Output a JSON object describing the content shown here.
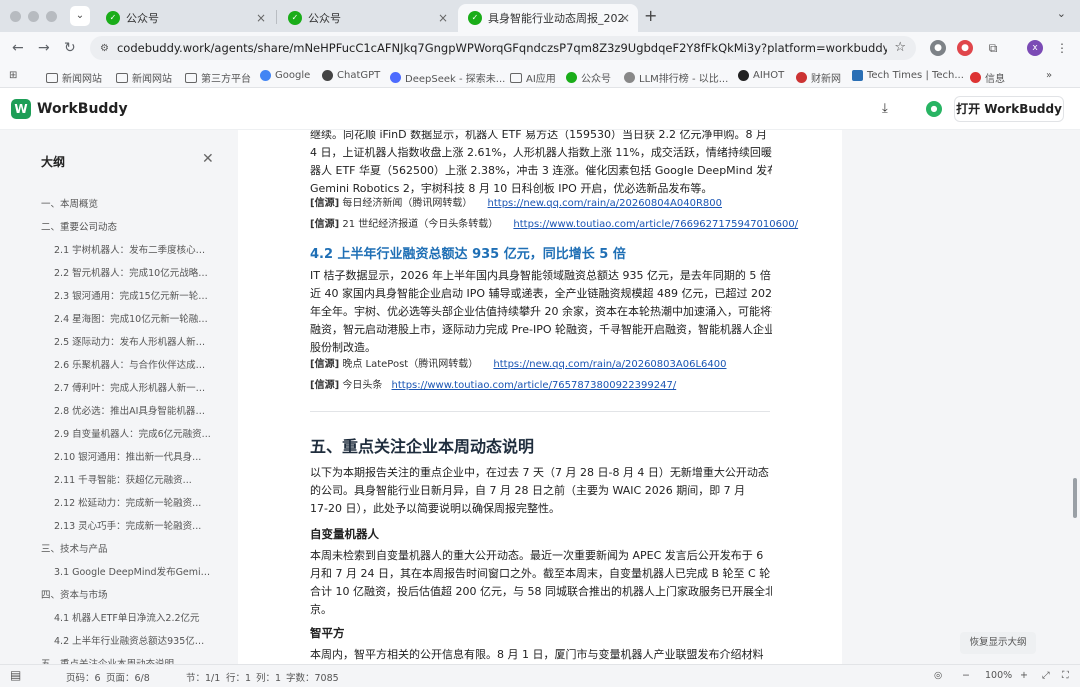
{
  "browser": {
    "tabs": [
      {
        "title": "公众号",
        "active": false
      },
      {
        "title": "公众号",
        "active": false
      },
      {
        "title": "具身智能行业动态周报_20260",
        "active": true
      }
    ],
    "tab_dropdown": "⌄",
    "new_tab": "+",
    "url": "codebuddy.work/agents/share/mNeHPFucC1cAFNJkq7GngpWPWorqGFqndczsP7qm8Z3z9UgbdqeF2Y8fFkQkMi3y?platform=workbuddy&ext2=brow...",
    "bookmarks": [
      "新闻网站",
      "新闻网站",
      "第三方平台",
      "Google",
      "ChatGPT",
      "DeepSeek - 探索未...",
      "AI应用",
      "公众号",
      "LLM排行榜 - 以比...",
      "AIHOT",
      "财新网",
      "Tech Times | Tech...",
      "信息"
    ],
    "ext_profile": "x"
  },
  "app": {
    "title": "WorkBuddy",
    "open_button": "打开 WorkBuddy"
  },
  "outline": {
    "title": "大纲",
    "items": [
      "一、本周概览",
      "二、重要公司动态",
      "2.1 宇树机器人：发布二季度核心进...",
      "2.2 智元机器人：完成10亿元战略投资...",
      "2.3 银河通用：完成15亿元新一轮融资...",
      "2.4 星海图：完成10亿元新一轮融资...",
      "2.5 逐际动力：发布人形机器人新品...",
      "2.6 乐聚机器人：与合作伙伴达成战略...",
      "2.7 傅利叶：完成人形机器人新一轮...",
      "2.8 优必选：推出AI具身智能机器人...",
      "2.9 自变量机器人：完成6亿元融资...",
      "2.10 银河通用：推出新一代具身...",
      "2.11 千寻智能：获超亿元融资...",
      "2.12 松延动力：完成新一轮融资...",
      "2.13 灵心巧手：完成新一轮融资...",
      "三、技术与产品",
      "3.1 Google DeepMind发布Gemini R...",
      "四、资本与市场",
      "4.1 机器人ETF单日净流入2.2亿元",
      "4.2 上半年行业融资总额达935亿元...",
      "五、重点关注企业本周动态说明"
    ]
  },
  "document": {
    "top_lines": [
      "继续。同花顺 iFinD 数据显示，机器人 ETF 易方达（159530）当日获 2.2 亿元净申购。8 月",
      "4 日，上证机器人指数收盘上涨 2.61%，人形机器人指数上涨 11%，成交活跃，情绪持续回暖。机",
      "器人 ETF 华夏（562500）上涨 2.38%，冲击 3 连涨。催化因素包括 Google DeepMind 发布",
      "Gemini Robotics 2，宇树科技 8 月 10 日科创板 IPO 开启，优必选新品发布等。"
    ],
    "src1": {
      "label": "[信源]",
      "name": "每日经济新闻（腾讯网转载）",
      "link": "https://new.qq.com/rain/a/20260804A040R800"
    },
    "src2": {
      "label": "[信源]",
      "name": "21 世纪经济报道（今日头条转载）",
      "link": "https://www.toutiao.com/article/7669627175947010600/"
    },
    "h42": "4.2 上半年行业融资总额达 935 亿元，同比增长 5 倍",
    "p42": [
      "IT 桔子数据显示，2026 年上半年国内具身智能领域融资总额达 935 亿元，是去年同期的 5 倍；",
      "近 40 家国内具身智能企业启动 IPO 辅导或递表，全产业链融资规模超 489 亿元，已超过 2025",
      "年全年。宇树、优必选等头部企业估值持续攀升 20 余家，资本在本轮热潮中加速涌入，可能将有 73 家企业在今年完成首轮",
      "融资，智元启动港股上市，逐际动力完成 Pre-IPO 轮融资，千寻智能开启融资，智能机器人企业完成",
      "股份制改造。"
    ],
    "src3": {
      "label": "[信源]",
      "name": "晚点 LatePost（腾讯网转载）",
      "link": "https://new.qq.com/rain/a/20260803A06L6400"
    },
    "src4": {
      "label": "[信源]",
      "name": "今日头条",
      "link": "https://www.toutiao.com/article/7657873800922399247/"
    },
    "h5": "五、重点关注企业本周动态说明",
    "p5": [
      "以下为本期报告关注的重点企业中，在过去 7 天（7 月 28 日-8 月 4 日）无新增重大公开动态",
      "的公司。具身智能行业日新月异，自 7 月 28 日之前（主要为 WAIC 2026 期间，即 7 月",
      "17-20 日），此处予以简要说明以确保周报完整性。"
    ],
    "s1": "自变量机器人",
    "p_s1": [
      "本周未检索到自变量机器人的重大公开动态。最近一次重要新闻为 APEC 发言后公开发布于 6",
      "月和 7 月 24 日，其在本周报告时间窗口之外。截至本周末，自变量机器人已完成 B 轮至 C 轮",
      "合计 10 亿融资，投后估值超 200 亿元，与 58 同城联合推出的机器人上门家政服务已开展全北",
      "京。"
    ],
    "s2": "智平方",
    "p_s2": "本周内，智平方相关的公开信息有限。8 月 1 日，厦门市与变量机器人产业联盟发布介绍材料"
  },
  "toc_button": "恢复显示大纲",
  "statusbar": {
    "words": "页码：6",
    "page": "页面：6/8",
    "section": "节：1/1",
    "pos": "行：1",
    "col": "列：1",
    "count": "字数：7085",
    "zoom": "100%"
  }
}
